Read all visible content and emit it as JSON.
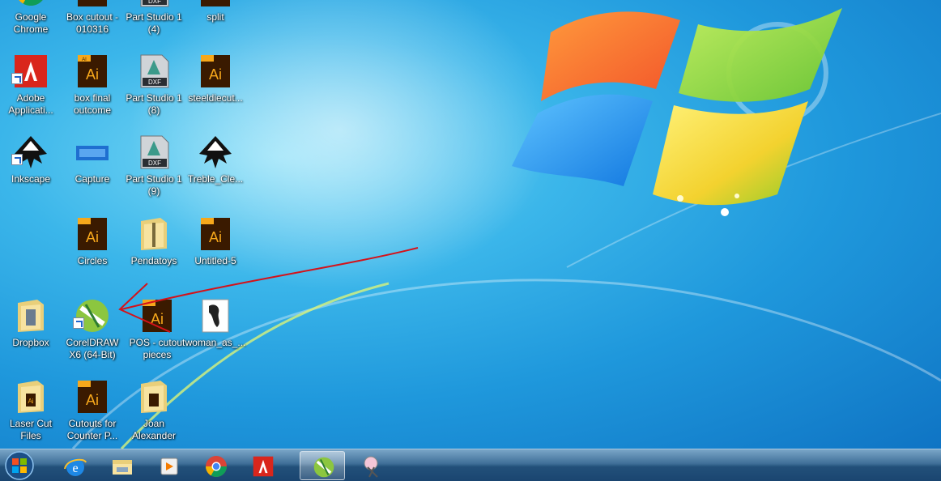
{
  "desktop": {
    "icons": [
      {
        "label": "Google Chrome",
        "kind": "chrome-icon"
      },
      {
        "label": "Box cutout - 010316",
        "kind": "ai-file-icon"
      },
      {
        "label": "Part Studio 1 (4)",
        "kind": "dxf-file-icon"
      },
      {
        "label": "split",
        "kind": "ai-file-icon"
      },
      {
        "label": "Adobe Applicati...",
        "kind": "adobe-icon"
      },
      {
        "label": "box final outcome",
        "kind": "ai-file-icon"
      },
      {
        "label": "Part Studio 1 (8)",
        "kind": "dxf-file-icon"
      },
      {
        "label": "steeldiecut...",
        "kind": "ai-file-icon"
      },
      {
        "label": "Inkscape",
        "kind": "inkscape-icon"
      },
      {
        "label": "Capture",
        "kind": "image-file-icon"
      },
      {
        "label": "Part Studio 1 (9)",
        "kind": "dxf-file-icon"
      },
      {
        "label": "Treble_Cle...",
        "kind": "inkscape-icon"
      },
      {
        "label": "Circles",
        "kind": "ai-file-icon"
      },
      {
        "label": "Pendatoys",
        "kind": "zip-folder-icon"
      },
      {
        "label": "Untitled-5",
        "kind": "ai-file-icon"
      },
      {
        "label": "Dropbox",
        "kind": "folder-icon"
      },
      {
        "label": "CorelDRAW X6 (64-Bit)",
        "kind": "coreldraw-icon"
      },
      {
        "label": "POS - cutout pieces",
        "kind": "ai-file-icon"
      },
      {
        "label": "woman_as_...",
        "kind": "image-file-icon"
      },
      {
        "label": "Laser Cut Files",
        "kind": "folder-icon"
      },
      {
        "label": "Cutouts for Counter P...",
        "kind": "ai-file-icon"
      },
      {
        "label": "Joan Alexander",
        "kind": "folder-icon"
      }
    ],
    "ai_badge": "Ai",
    "ai_tag": "AI",
    "dxf_badge": "DXF"
  },
  "taskbar": {
    "items": [
      {
        "name": "start-button",
        "icon": "windows-orb-icon"
      },
      {
        "name": "internet-explorer",
        "icon": "ie-icon"
      },
      {
        "name": "windows-explorer",
        "icon": "folder-icon"
      },
      {
        "name": "media-player",
        "icon": "media-player-icon"
      },
      {
        "name": "google-chrome",
        "icon": "chrome-icon"
      },
      {
        "name": "adobe",
        "icon": "adobe-icon"
      },
      {
        "name": "coreldraw",
        "icon": "coreldraw-icon",
        "active": true
      },
      {
        "name": "snipping-tool",
        "icon": "snipping-tool-icon"
      }
    ]
  },
  "colors": {
    "annotation": "#d4121a",
    "adobe_red": "#d9261c",
    "ai_orange": "#f7a81b",
    "ai_dark": "#3a1a00"
  }
}
